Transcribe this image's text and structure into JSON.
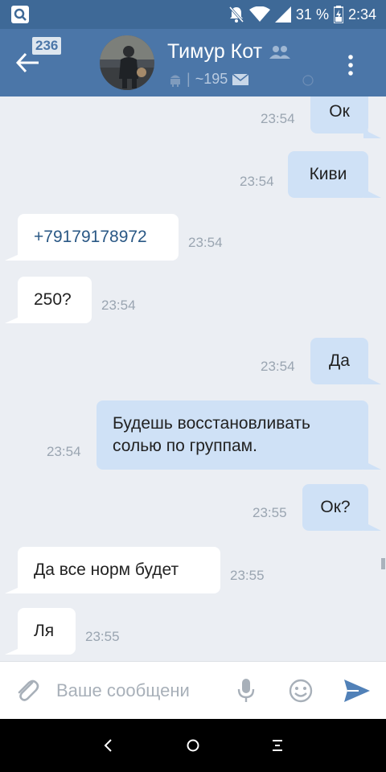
{
  "status_bar": {
    "battery_percent": "31 %",
    "time": "2:34"
  },
  "header": {
    "unread_count": "236",
    "contact_name": "Тимур Кот",
    "subtitle_count": "~195"
  },
  "messages": [
    {
      "text": "Ок",
      "time": "23:54",
      "direction": "out"
    },
    {
      "text": "Киви",
      "time": "23:54",
      "direction": "out"
    },
    {
      "text": "+79179178972",
      "time": "23:54",
      "direction": "in"
    },
    {
      "text": "250?",
      "time": "23:54",
      "direction": "in"
    },
    {
      "text": "Да",
      "time": "23:54",
      "direction": "out"
    },
    {
      "text": "Будешь восстановливать солью по группам.",
      "time": "23:54",
      "direction": "out"
    },
    {
      "text": "Ок?",
      "time": "23:55",
      "direction": "out"
    },
    {
      "text": "Да все норм будет",
      "time": "23:55",
      "direction": "in"
    },
    {
      "text": "Ля",
      "time": "23:55",
      "direction": "in"
    }
  ],
  "composer": {
    "placeholder": "Ваше сообщени"
  },
  "colors": {
    "header": "#4b76a8",
    "status_bar": "#3e6997",
    "outgoing_bubble": "#cfe1f6",
    "incoming_bubble": "#ffffff",
    "chat_background": "#ebeef3"
  }
}
